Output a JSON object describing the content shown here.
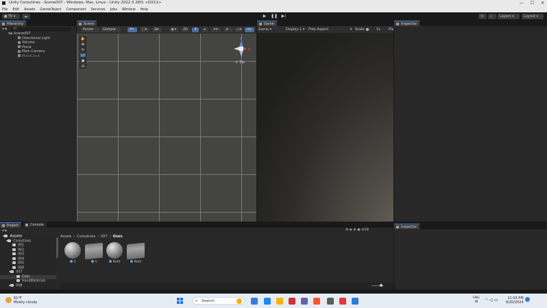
{
  "window": {
    "title": "Unity Coroutines - Scene007 - Windows, Mac, Linux - Unity 2022.3.28f1 <DX11>",
    "controls": [
      "—",
      "☐",
      "✕"
    ]
  },
  "menu": [
    "File",
    "Edit",
    "Assets",
    "GameObject",
    "Component",
    "Services",
    "Jobs",
    "Window",
    "Help"
  ],
  "toolbar": {
    "account": "TK",
    "layers": "Layers",
    "layout": "Layout"
  },
  "hierarchy": {
    "tab": "Hierarchy",
    "search_placeholder": "All",
    "scene": "Scene007",
    "items": [
      "Directional Light",
      "Volume",
      "Plane",
      "Main Camera",
      "MakeClock"
    ]
  },
  "scene": {
    "tab": "Scene",
    "pivot": "Pivot",
    "global": "Global",
    "mode_2d": "2D",
    "gizmo_label": "Top",
    "gizmo_axes": {
      "x": "x",
      "y": "y"
    }
  },
  "game": {
    "tab": "Game",
    "mode": "Game",
    "display": "Display 1",
    "aspect": "Free Aspect",
    "scale_label": "Scale",
    "scale_value": "1x",
    "play": "Pla"
  },
  "inspector": {
    "tab_top": "Inspector",
    "tab_bottom": "Inspector"
  },
  "project": {
    "tab_project": "Project",
    "tab_console": "Console",
    "count_badge": "19",
    "breadcrumb": [
      "Assets",
      "Coroutines",
      "007",
      "Dials"
    ],
    "tree": [
      {
        "label": "Assets",
        "level": 0
      },
      {
        "label": "Coroutines",
        "level": 1
      },
      {
        "label": "001",
        "level": 2
      },
      {
        "label": "002",
        "level": 2
      },
      {
        "label": "003",
        "level": 2
      },
      {
        "label": "004",
        "level": 2
      },
      {
        "label": "005",
        "level": 2
      },
      {
        "label": "006",
        "level": 2
      },
      {
        "label": "007",
        "level": 2
      },
      {
        "label": "Dials",
        "level": 3
      },
      {
        "label": "HandMaterials",
        "level": 3
      },
      {
        "label": "008",
        "level": 2
      }
    ],
    "assets": [
      {
        "label": "S",
        "kind": "sphere"
      },
      {
        "label": "S",
        "kind": "dial"
      },
      {
        "label": "NotS",
        "kind": "sphere"
      },
      {
        "label": "NotS",
        "kind": "dial"
      }
    ]
  },
  "taskbar": {
    "weather_temp": "61°F",
    "weather_desc": "Mostly cloudy",
    "search": "Search",
    "lang_top": "ENG",
    "lang_bottom": "IN",
    "time": "11:03 PM",
    "date": "6/20/2024",
    "icon_colors": [
      "#3b7bd8",
      "#1e88e5",
      "#f4b400",
      "#d32f2f",
      "#6264a7",
      "#fb542b",
      "#5c5c5c",
      "#e53935",
      "#2f7bd6"
    ]
  }
}
